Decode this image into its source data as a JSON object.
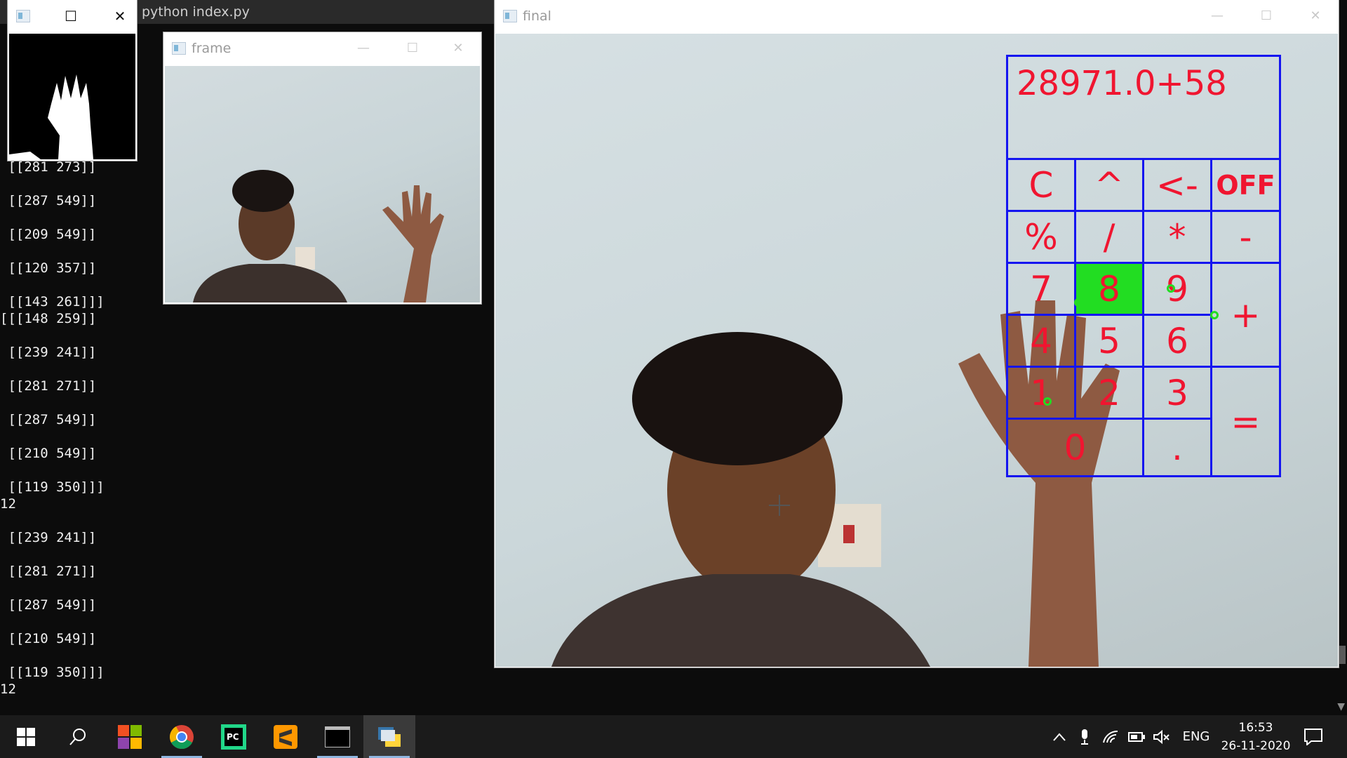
{
  "console": {
    "title": "python  index.py",
    "lines": [
      "[[281 273]]",
      "",
      "[[287 549]]",
      "",
      "[[209 549]]",
      "",
      "[[120 357]]",
      "",
      "[[143 261]]]",
      "[[[148 259]]",
      "",
      "[[239 241]]",
      "",
      "[[281 271]]",
      "",
      "[[287 549]]",
      "",
      "[[210 549]]",
      "",
      "[[119 350]]]",
      "12",
      "",
      "[[239 241]]",
      "",
      "[[281 271]]",
      "",
      "[[287 549]]",
      "",
      "[[210 549]]",
      "",
      "[[119 350]]]",
      "12"
    ]
  },
  "windows": {
    "mask": {
      "title": ""
    },
    "frame": {
      "title": "frame"
    },
    "final": {
      "title": "final"
    }
  },
  "calculator": {
    "display": "28971.0+58",
    "keys": [
      "C",
      "^",
      "<-",
      "OFF",
      "%",
      "/",
      "*",
      "-",
      "7",
      "8",
      "9",
      "+",
      "4",
      "5",
      "6",
      "1",
      "2",
      "3",
      "=",
      "0",
      "."
    ],
    "active_key": "8",
    "colors": {
      "grid": "#1515f0",
      "text": "#f01530",
      "highlight": "#22dd22"
    }
  },
  "taskbar": {
    "apps": [
      "start-icon",
      "search-icon",
      "store-icon",
      "chrome-icon",
      "pycharm-icon",
      "sublime-icon",
      "terminal-icon",
      "python-icon"
    ],
    "lang": "ENG",
    "time": "16:53",
    "date": "26-11-2020"
  }
}
